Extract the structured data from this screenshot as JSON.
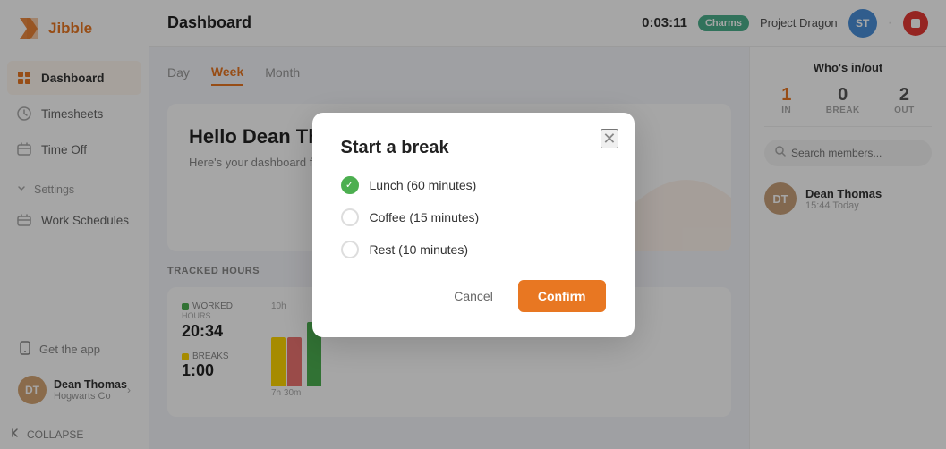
{
  "sidebar": {
    "logo_text": "Jibble",
    "nav_items": [
      {
        "id": "dashboard",
        "label": "Dashboard",
        "active": true
      },
      {
        "id": "timesheets",
        "label": "Timesheets",
        "active": false
      },
      {
        "id": "timeoff",
        "label": "Time Off",
        "active": false
      }
    ],
    "settings_label": "Settings",
    "work_schedules_label": "Work Schedules",
    "get_app_label": "Get the app",
    "collapse_label": "COLLAPSE",
    "user": {
      "name": "Dean Thomas",
      "company": "Hogwarts Co",
      "initials": "DT"
    }
  },
  "header": {
    "title": "Dashboard",
    "timer": "0:03:11",
    "badge": "Charms",
    "project": "Project Dragon",
    "user_initials": "ST"
  },
  "tabs": [
    {
      "label": "Day",
      "active": false
    },
    {
      "label": "Week",
      "active": true
    },
    {
      "label": "Month",
      "active": false
    }
  ],
  "hello": {
    "title": "Hello Dean Th",
    "subtitle": "Here's your dashboard fo"
  },
  "tracked_hours": {
    "section_title": "TRACKED HOURS",
    "worked_label": "WORKED",
    "worked_hours": "HOURS",
    "worked_value": "20:34",
    "breaks_label": "BREAKS",
    "breaks_value": "1:00",
    "y_labels": [
      "10h",
      "7h 30m"
    ]
  },
  "whos_in": {
    "title": "Who's in/out",
    "in_count": "1",
    "in_label": "IN",
    "break_count": "0",
    "break_label": "BREAK",
    "out_count": "2",
    "out_label": "OUT",
    "search_placeholder": "Search members...",
    "members": [
      {
        "name": "Dean Thomas",
        "time": "15:44 Today",
        "initials": "DT"
      }
    ]
  },
  "modal": {
    "title": "Start a break",
    "options": [
      {
        "id": "lunch",
        "label": "Lunch (60 minutes)",
        "checked": true
      },
      {
        "id": "coffee",
        "label": "Coffee (15 minutes)",
        "checked": false
      },
      {
        "id": "rest",
        "label": "Rest (10 minutes)",
        "checked": false
      }
    ],
    "cancel_label": "Cancel",
    "confirm_label": "Confirm"
  },
  "colors": {
    "orange": "#e87722",
    "green": "#4caf50",
    "red": "#e53935",
    "teal": "#4caf8c"
  }
}
